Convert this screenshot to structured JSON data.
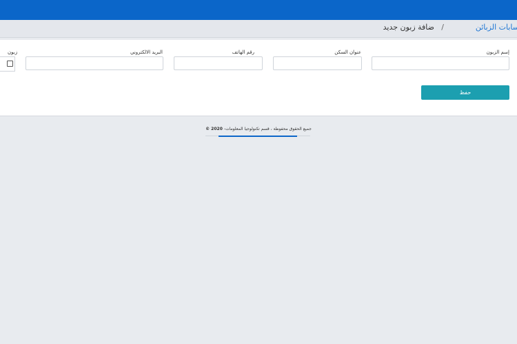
{
  "breadcrumb": {
    "link": "سابات الزبائن",
    "separator": "/",
    "current": "ضافة زبون جديد"
  },
  "form": {
    "fields": [
      {
        "label": "إسم الزبون",
        "value": ""
      },
      {
        "label": "عنوان السكن",
        "value": ""
      },
      {
        "label": "رقم الهاتف",
        "value": ""
      },
      {
        "label": "البريد الالكتروني",
        "value": ""
      }
    ],
    "checkbox_label": "زبون",
    "save_label": "حفظ"
  },
  "footer": {
    "year": "© 2020",
    "text": "-جميع الحقوق محفوظة ، قسم تكنولوجيا المعلومات"
  },
  "colors": {
    "topbar": "#0b66c9",
    "link": "#1e76d3",
    "save_button": "#1c9fb0"
  }
}
